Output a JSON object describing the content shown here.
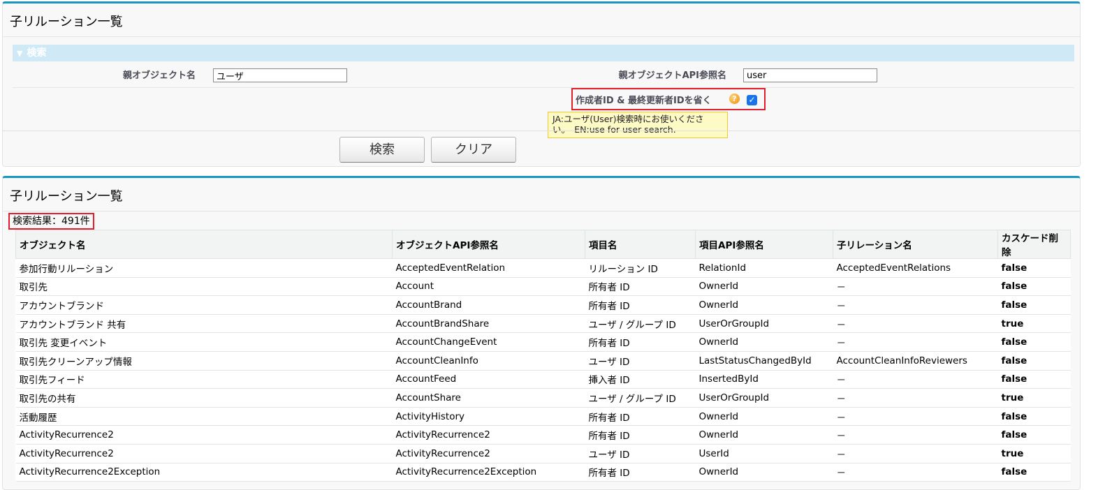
{
  "search_panel": {
    "title": "子リルーション一覧",
    "section_label": "検索",
    "parent_object_label": "親オブジェクト名",
    "parent_object_value": "ユーザ",
    "parent_api_label": "親オブジェクトAPI参照名",
    "parent_api_value": "user",
    "exclude_label": "作成者ID & 最終更新者IDを省く",
    "exclude_checked": true,
    "tooltip_line1": "JA:ユーザ(User)検索時にお使いくださ",
    "tooltip_line2": "い。　EN:use for user search.",
    "search_button": "検索",
    "clear_button": "クリア"
  },
  "results_panel": {
    "title": "子リルーション一覧",
    "result_count": "検索結果：491件",
    "columns": [
      "オブジェクト名",
      "オブジェクトAPI参照名",
      "項目名",
      "項目API参照名",
      "子リレーション名",
      "カスケード削除"
    ],
    "rows": [
      [
        "参加行動リルーション",
        "AcceptedEventRelation",
        "リルーション ID",
        "RelationId",
        "AcceptedEventRelations",
        "false"
      ],
      [
        "取引先",
        "Account",
        "所有者 ID",
        "OwnerId",
        "－",
        "false"
      ],
      [
        "アカウントブランド",
        "AccountBrand",
        "所有者 ID",
        "OwnerId",
        "－",
        "false"
      ],
      [
        "アカウントブランド 共有",
        "AccountBrandShare",
        "ユーザ / グループ ID",
        "UserOrGroupId",
        "－",
        "true"
      ],
      [
        "取引先 変更イベント",
        "AccountChangeEvent",
        "所有者 ID",
        "OwnerId",
        "－",
        "false"
      ],
      [
        "取引先クリーンアップ情報",
        "AccountCleanInfo",
        "ユーザ ID",
        "LastStatusChangedById",
        "AccountCleanInfoReviewers",
        "false"
      ],
      [
        "取引先フィード",
        "AccountFeed",
        "挿入者 ID",
        "InsertedById",
        "－",
        "false"
      ],
      [
        "取引先の共有",
        "AccountShare",
        "ユーザ / グループ ID",
        "UserOrGroupId",
        "－",
        "true"
      ],
      [
        "活動履歴",
        "ActivityHistory",
        "所有者 ID",
        "OwnerId",
        "－",
        "false"
      ],
      [
        "ActivityRecurrence2",
        "ActivityRecurrence2",
        "所有者 ID",
        "OwnerId",
        "－",
        "false"
      ],
      [
        "ActivityRecurrence2",
        "ActivityRecurrence2",
        "ユーザ ID",
        "UserId",
        "－",
        "true"
      ],
      [
        "ActivityRecurrence2Exception",
        "ActivityRecurrence2Exception",
        "所有者 ID",
        "OwnerId",
        "－",
        "false"
      ]
    ]
  },
  "colors": {
    "accent": "#1797c0",
    "section_bar": "#cfeaf6",
    "highlight": "#e41d2c",
    "false_text": "#e41d2c",
    "true_text": "#1a8a1a"
  }
}
